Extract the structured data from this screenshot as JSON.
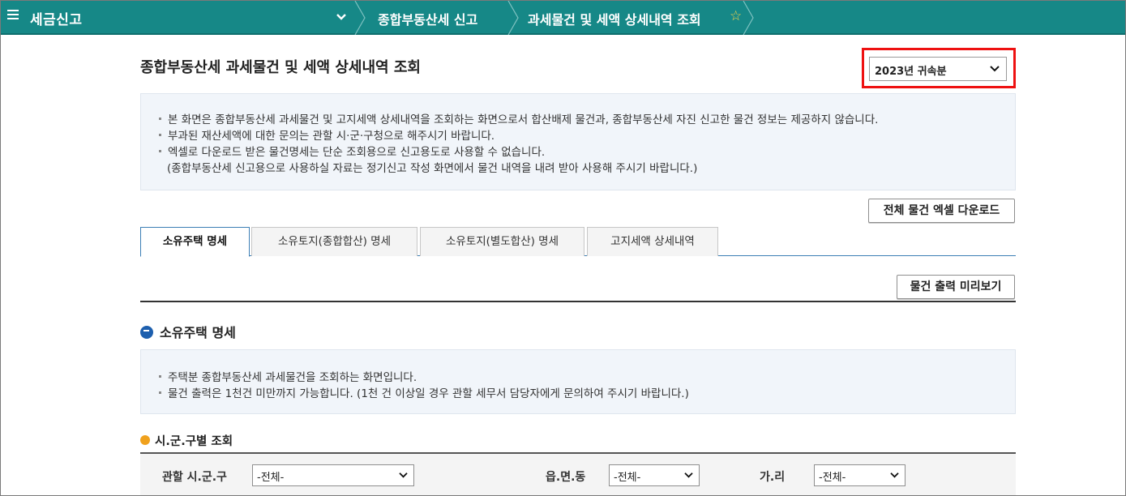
{
  "nav": {
    "home_title": "세금신고",
    "breadcrumbs": [
      "종합부동산세 신고",
      "과세물건 및 세액 상세내역 조회"
    ],
    "favorite_icon": "star-icon"
  },
  "header": {
    "title": "종합부동산세 과세물건 및 세액 상세내역 조회",
    "year_select": "2023년 귀속분"
  },
  "notice": [
    "본 화면은 종합부동산세 과세물건 및 고지세액 상세내역을 조회하는 화면으로서 합산배제 물건과, 종합부동산세 자진 신고한 물건 정보는 제공하지 않습니다.",
    "부과된 재산세액에 대한 문의는 관할 시·군·구청으로 해주시기 바랍니다.",
    "엑셀로 다운로드 받은 물건명세는 단순 조회용으로 신고용도로 사용할 수 없습니다.",
    "(종합부동산세 신고용으로 사용하실 자료는 정기신고 작성 화면에서 물건 내역을 내려 받아 사용해 주시기 바랍니다.)"
  ],
  "buttons": {
    "excel_download": "전체 물건 엑셀 다운로드",
    "print_preview": "물건 출력 미리보기"
  },
  "tabs": [
    {
      "label": "소유주택 명세",
      "active": true
    },
    {
      "label": "소유토지(종합합산) 명세",
      "active": false
    },
    {
      "label": "소유토지(별도합산) 명세",
      "active": false
    },
    {
      "label": "고지세액 상세내역",
      "active": false
    }
  ],
  "section": {
    "title": "소유주택 명세",
    "notice": [
      "주택분 종합부동산세 과세물건을 조회하는 화면입니다.",
      "물건 출력은 1천건 미만까지 가능합니다. (1천 건 이상일 경우 관할 세무서 담당자에게 문의하여 주시기 바랍니다.)"
    ]
  },
  "filter": {
    "title": "시.군.구별 조회",
    "sigungu_label": "관할 시.군.구",
    "sigungu_value": "-전체-",
    "eupmyeondong_label": "읍.면.동",
    "eupmyeondong_value": "-전체-",
    "gari_label": "가.리",
    "gari_value": "-전체-"
  },
  "colors": {
    "nav_bg": "#168887",
    "highlight_border": "#ee1111",
    "tab_accent": "#3c7fb5",
    "notice_bg": "#f1f5fa"
  }
}
